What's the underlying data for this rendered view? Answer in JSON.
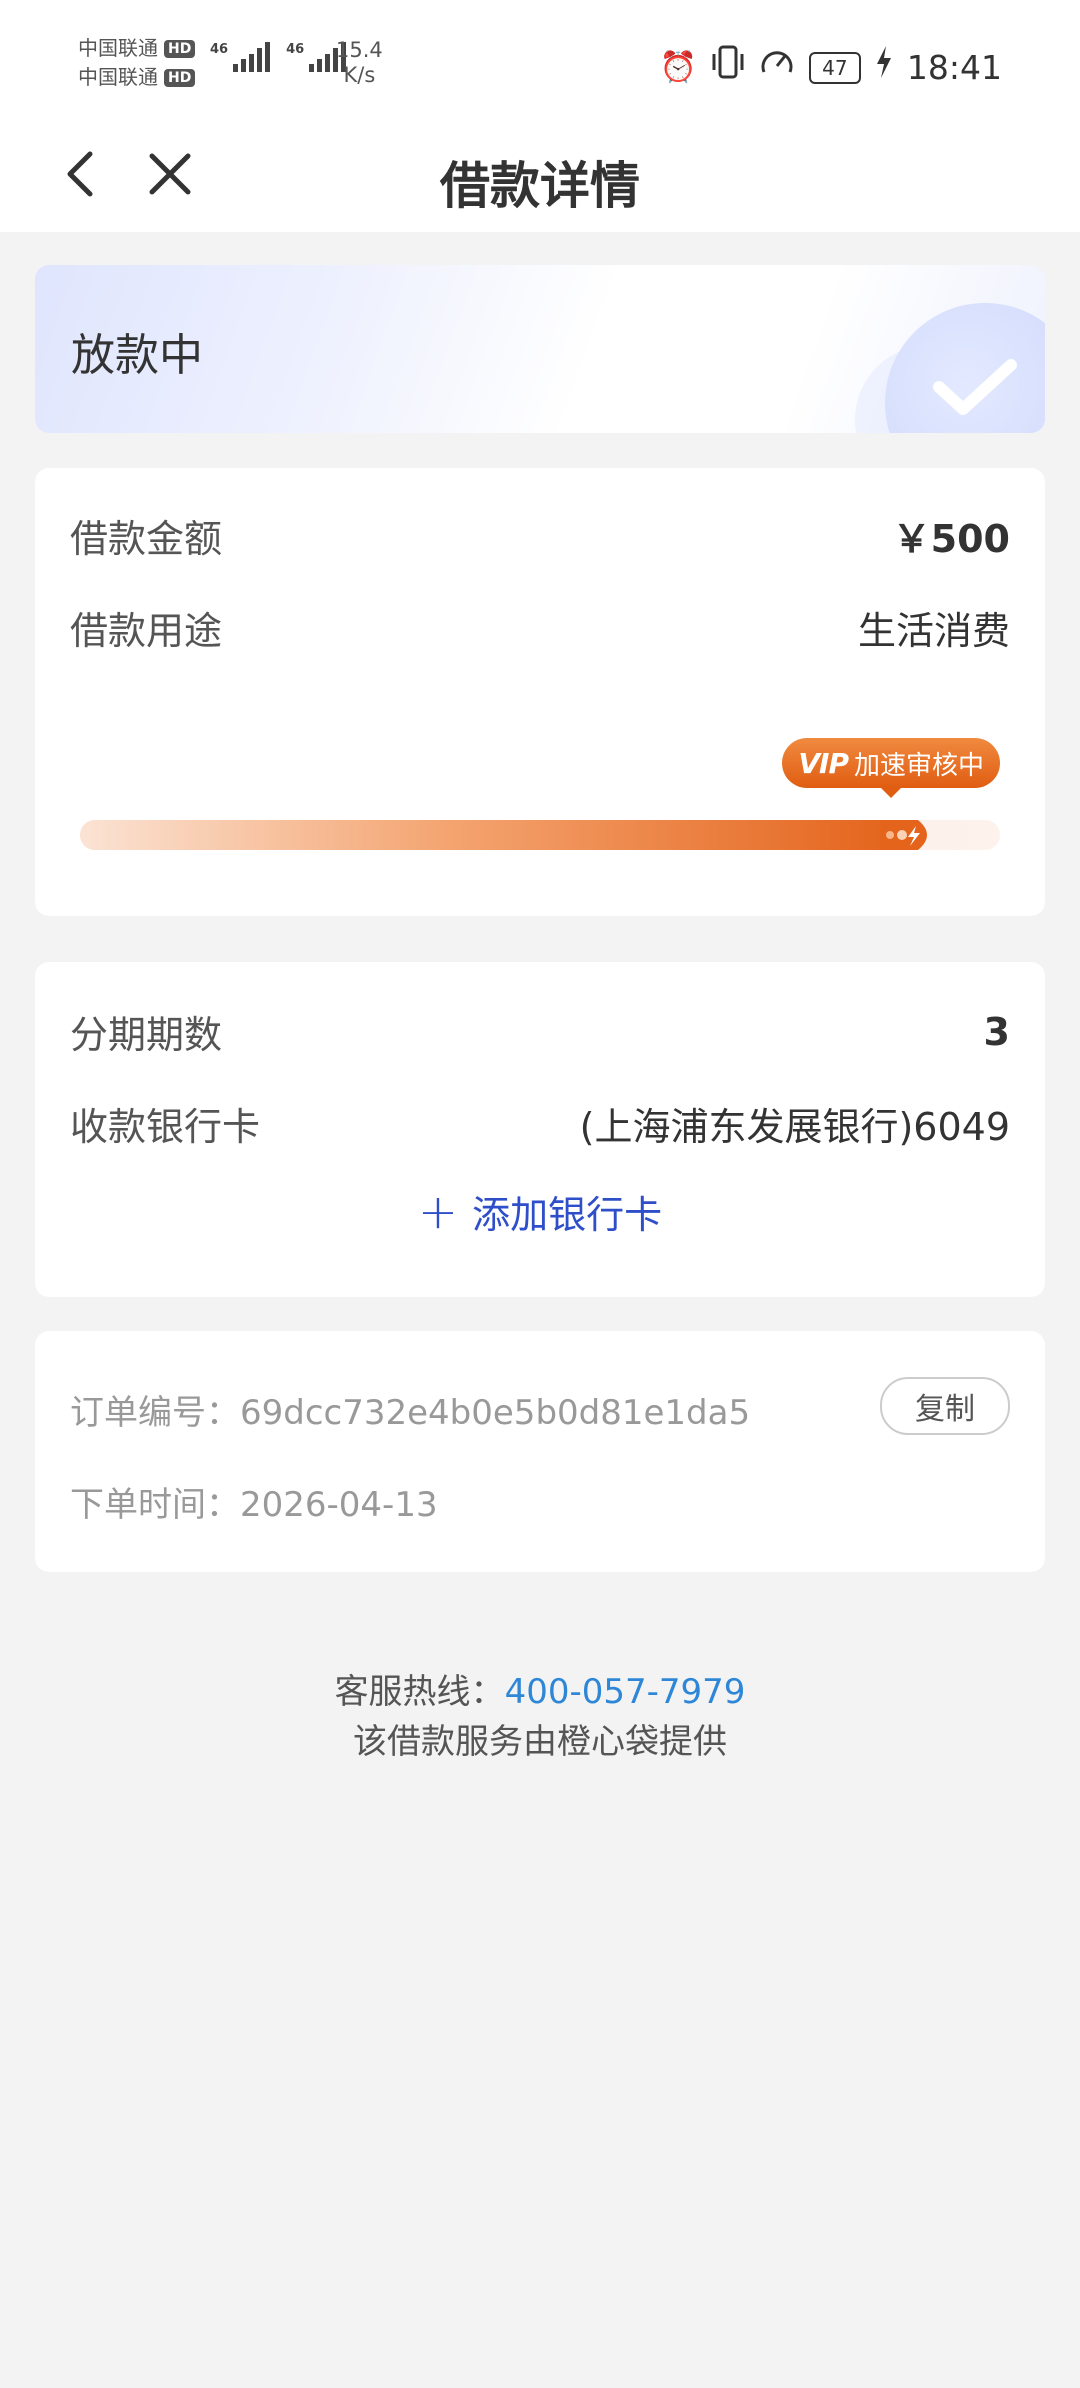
{
  "status_bar": {
    "carrier1": "中国联通",
    "carrier2": "中国联通",
    "hd_label": "HD",
    "network1": "46",
    "network2": "46",
    "speed_value": "15.4",
    "speed_unit": "K/s",
    "battery": "47",
    "time": "18:41"
  },
  "nav": {
    "title": "借款详情"
  },
  "status_card": {
    "status": "放款中"
  },
  "loan": {
    "amount_label": "借款金额",
    "amount_value": "￥500",
    "purpose_label": "借款用途",
    "purpose_value": "生活消费",
    "vip_text": "VIP",
    "vip_status": "加速审核中",
    "progress_fraction": 0.93
  },
  "bank": {
    "installments_label": "分期期数",
    "installments_value": "3",
    "bank_card_label": "收款银行卡",
    "bank_card_value": "(上海浦东发展银行)6049",
    "add_bank_label": "添加银行卡"
  },
  "order": {
    "order_no_label": "订单编号：",
    "order_no_value": "69dcc732e4b0e5b0d81e1da5",
    "copy_label": "复制",
    "order_time_label": "下单时间：",
    "order_time_value": "2026-04-13"
  },
  "footer": {
    "hotline_label": "客服热线：",
    "hotline_number": "400-057-7979",
    "provider_text": "该借款服务由橙心袋提供"
  },
  "colors": {
    "accent_blue": "#2e4fc9",
    "hotline_blue": "#2d87d6",
    "progress_orange": "#e4641c"
  }
}
